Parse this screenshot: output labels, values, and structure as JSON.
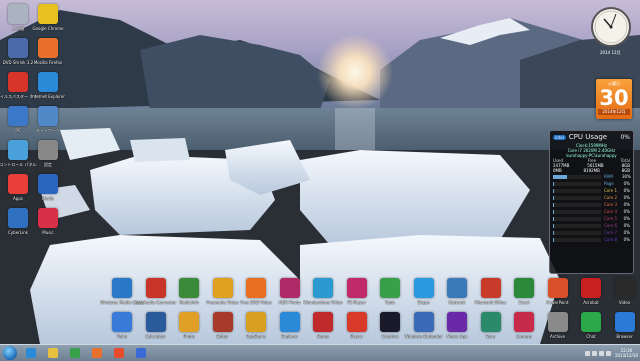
{
  "desktop_icons": [
    {
      "label": "ごみ箱",
      "icon": "recycle-bin-icon",
      "color": "#aab4c0"
    },
    {
      "label": "DVD Shrink 3.2",
      "icon": "dvd-shrink-icon",
      "color": "#4a6aa8"
    },
    {
      "label": "ウイルスバスター クラウド",
      "icon": "antivirus-icon",
      "color": "#d8342a"
    },
    {
      "label": "PC",
      "icon": "pc-icon",
      "color": "#3c78c8"
    },
    {
      "label": "コントロール パネル",
      "icon": "control-panel-icon",
      "color": "#4aa0d8"
    },
    {
      "label": "Apps",
      "icon": "apps-icon",
      "color": "#e84038"
    },
    {
      "label": "CyberLink",
      "icon": "cyberlink-icon",
      "color": "#3070c0"
    },
    {
      "label": "Google Chrome",
      "icon": "chrome-icon",
      "color": "#e8c020"
    },
    {
      "label": "Mozilla Firefox",
      "icon": "firefox-icon",
      "color": "#e8702a"
    },
    {
      "label": "Internet Explorer",
      "icon": "internet-explorer-icon",
      "color": "#2a8ad8"
    },
    {
      "label": "ネットワーク",
      "icon": "network-icon",
      "color": "#5088c8"
    },
    {
      "label": "設定",
      "icon": "settings-icon",
      "color": "#888"
    },
    {
      "label": "Media",
      "icon": "media-icon",
      "color": "#2a66c0"
    },
    {
      "label": "Music",
      "icon": "music-icon",
      "color": "#d83048"
    }
  ],
  "app_row1": [
    {
      "label": "Windows Media Center",
      "icon": "media-center-icon",
      "color": "#2a78c8"
    },
    {
      "label": "Any Audio Converter",
      "icon": "audio-converter-icon",
      "color": "#c83428"
    },
    {
      "label": "MediaInfo",
      "icon": "mediainfo-icon",
      "color": "#3a8a3a"
    },
    {
      "label": "Freemake Video",
      "icon": "freemake-icon",
      "color": "#e0a020"
    },
    {
      "label": "Free DVD Video",
      "icon": "dvd-video-icon",
      "color": "#e87020"
    },
    {
      "label": "HDR Photo",
      "icon": "hdr-icon",
      "color": "#b02a68"
    },
    {
      "label": "Wondershare Video",
      "icon": "wondershare-icon",
      "color": "#2a9ad0"
    },
    {
      "label": "FS Player",
      "icon": "fs-player-icon",
      "color": "#c02a6a"
    },
    {
      "label": "Tools",
      "icon": "tools-icon",
      "color": "#38a048"
    },
    {
      "label": "Skype",
      "icon": "skype-icon",
      "color": "#2a9ae0"
    },
    {
      "label": "Network",
      "icon": "network-app-icon",
      "color": "#3a7ab8"
    },
    {
      "label": "Microsoft Office",
      "icon": "office-icon",
      "color": "#c83a2a"
    },
    {
      "label": "Excel",
      "icon": "excel-icon",
      "color": "#2a8a3a"
    },
    {
      "label": "PowerPoint",
      "icon": "powerpoint-icon",
      "color": "#d8502a"
    },
    {
      "label": "Acrobat",
      "icon": "acrobat-icon",
      "color": "#c82020"
    },
    {
      "label": "Video",
      "icon": "video-icon",
      "color": "#2a2a2a"
    }
  ],
  "app_row2": [
    {
      "label": "Paint",
      "icon": "paint-icon",
      "color": "#3a7ad8"
    },
    {
      "label": "Calculator",
      "icon": "calculator-icon",
      "color": "#2a5a9a"
    },
    {
      "label": "Photo",
      "icon": "photo-icon",
      "color": "#e0a028"
    },
    {
      "label": "Editor",
      "icon": "editor-icon",
      "color": "#a83a2a"
    },
    {
      "label": "FastStone",
      "icon": "faststone-icon",
      "color": "#d8a020"
    },
    {
      "label": "Explorer",
      "icon": "explorer-app-icon",
      "color": "#2a8ad8"
    },
    {
      "label": "Game",
      "icon": "game-icon",
      "color": "#c02a2a"
    },
    {
      "label": "Player",
      "icon": "player-icon",
      "color": "#d83a2a"
    },
    {
      "label": "Creative",
      "icon": "creative-icon",
      "color": "#1a1a2a"
    },
    {
      "label": "Windows Defender",
      "icon": "defender-icon",
      "color": "#3a6ab8"
    },
    {
      "label": "Music App",
      "icon": "music-app-icon",
      "color": "#6a2aa8"
    },
    {
      "label": "Sync",
      "icon": "sync-icon",
      "color": "#2a8a6a"
    },
    {
      "label": "Camera",
      "icon": "camera-icon",
      "color": "#c82a4a"
    },
    {
      "label": "Archive",
      "icon": "archive-icon",
      "color": "#8a8a8a"
    },
    {
      "label": "Chat",
      "icon": "chat-icon",
      "color": "#2aa84a"
    },
    {
      "label": "Browser",
      "icon": "browser-icon",
      "color": "#2a7ad8"
    }
  ],
  "gadgets": {
    "clock_date": "2014 12月",
    "calendar": {
      "weekday": "火曜日",
      "day": "30",
      "year_month": "2014年12月"
    },
    "cpu": {
      "title": "CPU Usage",
      "percent": "0%",
      "info1": "Clock:1599MHz",
      "info2": "Core i7 2620M 2.40GHz",
      "info3": "kurohappy-PC\\kurohappy",
      "headers": [
        "Used",
        "Free",
        "Total"
      ],
      "values": [
        "2477MB",
        "5615MB",
        "8GB"
      ],
      "values2": [
        "0MB",
        "8192MB",
        "8GB"
      ],
      "meters": [
        {
          "name": "RAM",
          "value": "30%",
          "level": 0.3
        },
        {
          "name": "Page",
          "value": "0%",
          "level": 0.0
        },
        {
          "name": "Core 1",
          "value": "0%",
          "level": 0.0
        },
        {
          "name": "Core 2",
          "value": "0%",
          "level": 0.0
        },
        {
          "name": "Core 3",
          "value": "0%",
          "level": 0.0
        },
        {
          "name": "Core 4",
          "value": "0%",
          "level": 0.0
        },
        {
          "name": "Core 5",
          "value": "0%",
          "level": 0.0
        },
        {
          "name": "Core 6",
          "value": "0%",
          "level": 0.0
        },
        {
          "name": "Core 7",
          "value": "0%",
          "level": 0.0
        },
        {
          "name": "Core 8",
          "value": "0%",
          "level": 0.0
        }
      ]
    }
  },
  "taskbar": {
    "pinned": [
      {
        "icon": "ie-taskbar-icon",
        "color": "#2a8ad8"
      },
      {
        "icon": "file-explorer-taskbar-icon",
        "color": "#e8c040"
      },
      {
        "icon": "store-taskbar-icon",
        "color": "#38a048"
      },
      {
        "icon": "firefox-taskbar-icon",
        "color": "#e8702a"
      },
      {
        "icon": "chrome-taskbar-icon",
        "color": "#e84a2a"
      },
      {
        "icon": "media-player-taskbar-icon",
        "color": "#3a6ad8"
      }
    ],
    "time": "22:26",
    "date": "2014/12/30"
  }
}
